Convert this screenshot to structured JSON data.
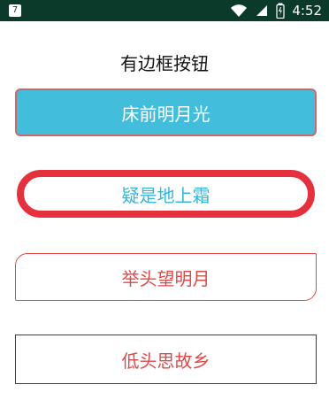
{
  "status_bar": {
    "notification_number": "7",
    "time": "4:52",
    "icons": [
      "wifi-icon",
      "signal-icon",
      "battery-icon"
    ]
  },
  "page": {
    "title": "有边框按钮"
  },
  "buttons": [
    {
      "label": "床前明月光"
    },
    {
      "label": "疑是地上霜"
    },
    {
      "label": "举头望明月"
    },
    {
      "label": "低头思故乡"
    }
  ],
  "colors": {
    "status_bar_bg": "#0b3a2a",
    "button1_fill": "#42bedc",
    "button2_border": "#e5313d",
    "button2_text": "#36b6d6",
    "button3_text": "#e04848",
    "button4_text": "#e04848"
  }
}
